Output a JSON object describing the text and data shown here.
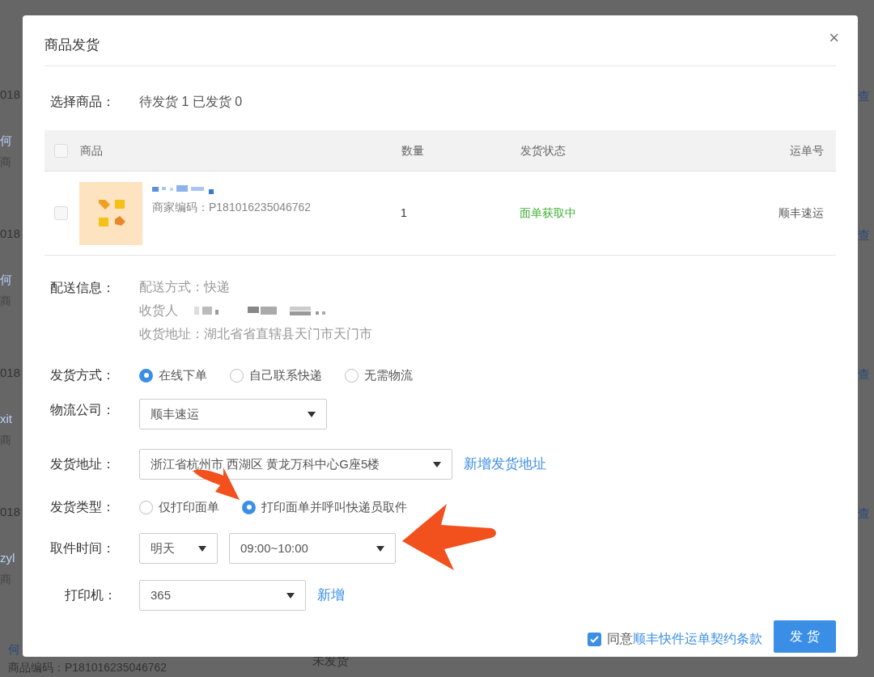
{
  "background": {
    "groups": [
      {
        "date": "018",
        "buyer": "何",
        "sub": "商",
        "action_1": "查"
      },
      {
        "date": "018",
        "buyer": "何",
        "sub": "商",
        "action_1": "查"
      },
      {
        "date": "018",
        "buyer": "xit",
        "sub": "商",
        "action_1": "查"
      },
      {
        "date": "018",
        "buyer": "zyl",
        "sub": "商",
        "action_1": "查"
      }
    ],
    "last_row": {
      "buyer": "何",
      "code": "商品编码：P181016235046762",
      "status": "未发货"
    }
  },
  "dialog": {
    "title": "商品发货",
    "close": "×",
    "select_goods": {
      "label": "选择商品：",
      "summary": "待发货 1 已发货 0"
    },
    "table": {
      "columns": [
        "商品",
        "数量",
        "发货状态",
        "运单号"
      ],
      "header_checked": false,
      "rows": [
        {
          "checked": false,
          "code": "商家编码：P181016235046762",
          "quantity": "1",
          "status": "面单获取中",
          "carrier": "顺丰速运"
        }
      ]
    },
    "delivery": {
      "label": "配送信息：",
      "method": "配送方式：快递",
      "recipient_label": "收货人",
      "address": "收货地址：湖北省省直辖县天门市天门市"
    },
    "shipping_method": {
      "label": "发货方式：",
      "options": [
        {
          "label": "在线下单",
          "selected": true
        },
        {
          "label": "自己联系快递",
          "selected": false
        },
        {
          "label": "无需物流",
          "selected": false
        }
      ]
    },
    "company": {
      "label": "物流公司：",
      "value": "顺丰速运"
    },
    "ship_address": {
      "label": "发货地址：",
      "value": "浙江省杭州市 西湖区 黄龙万科中心G座5楼",
      "link": "新增发货地址"
    },
    "ship_type": {
      "label": "发货类型：",
      "options": [
        {
          "label": "仅打印面单",
          "selected": false
        },
        {
          "label": "打印面单并呼叫快递员取件",
          "selected": true
        }
      ]
    },
    "pickup": {
      "label": "取件时间：",
      "day": "明天",
      "slot": "09:00~10:00"
    },
    "printer": {
      "label": "打印机：",
      "value": "365",
      "link": "新增"
    },
    "agree": {
      "checked": true,
      "prefix": "同意",
      "link": "顺丰快件运单契约条款"
    },
    "submit": "发 货"
  }
}
